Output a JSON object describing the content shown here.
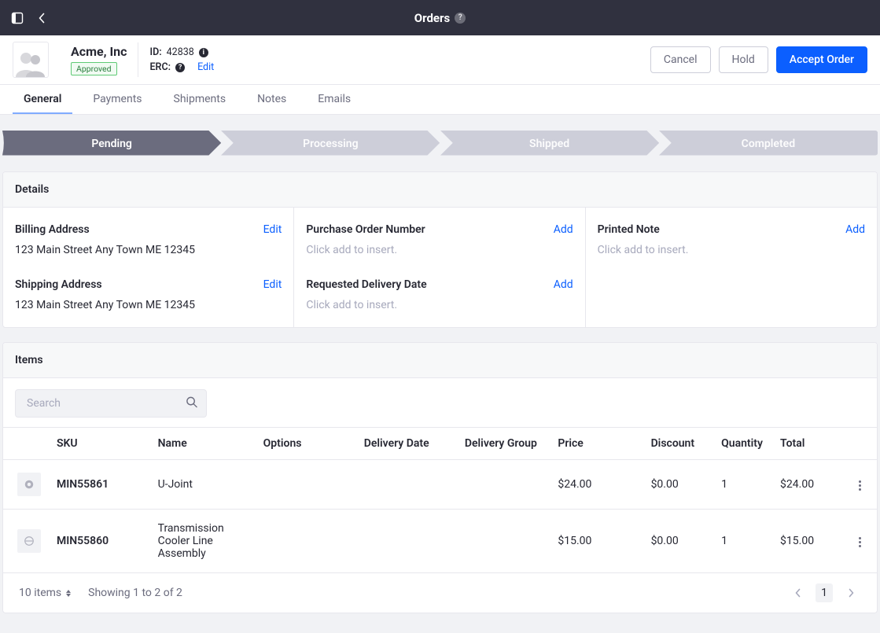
{
  "topbar": {
    "title": "Orders",
    "help_glyph": "?"
  },
  "header": {
    "customer_name": "Acme, Inc",
    "status_badge": "Approved",
    "id_label": "ID:",
    "id_value": "42838",
    "erc_label": "ERC:",
    "erc_help": "?",
    "edit_link": "Edit",
    "actions": {
      "cancel": "Cancel",
      "hold": "Hold",
      "accept": "Accept Order"
    }
  },
  "tabs": {
    "general": "General",
    "payments": "Payments",
    "shipments": "Shipments",
    "notes": "Notes",
    "emails": "Emails"
  },
  "steps": {
    "active_index": 0,
    "labels": {
      "pending": "Pending",
      "processing": "Processing",
      "shipped": "Shipped",
      "completed": "Completed"
    }
  },
  "details": {
    "panel_title": "Details",
    "billing_title": "Billing Address",
    "billing_value": "123 Main Street Any Town ME 12345",
    "billing_action": "Edit",
    "shipping_title": "Shipping Address",
    "shipping_value": "123 Main Street Any Town ME 12345",
    "shipping_action": "Edit",
    "po_title": "Purchase Order Number",
    "po_value": "Click add to insert.",
    "po_action": "Add",
    "date_title": "Requested Delivery Date",
    "date_value": "Click add to insert.",
    "date_action": "Add",
    "note_title": "Printed Note",
    "note_value": "Click add to insert.",
    "note_action": "Add"
  },
  "items": {
    "panel_title": "Items",
    "search_placeholder": "Search",
    "columns": {
      "sku": "SKU",
      "name": "Name",
      "options": "Options",
      "delivery_date": "Delivery Date",
      "delivery_group": "Delivery Group",
      "price": "Price",
      "discount": "Discount",
      "quantity": "Quantity",
      "total": "Total"
    },
    "rows": [
      {
        "sku": "MIN55861",
        "name": "U-Joint",
        "options": "",
        "delivery_date": "",
        "delivery_group": "",
        "price": "$24.00",
        "discount": "$0.00",
        "quantity": "1",
        "total": "$24.00"
      },
      {
        "sku": "MIN55860",
        "name": "Transmission Cooler Line Assembly",
        "options": "",
        "delivery_date": "",
        "delivery_group": "",
        "price": "$15.00",
        "discount": "$0.00",
        "quantity": "1",
        "total": "$15.00"
      }
    ],
    "footer": {
      "page_size_label": "10 items",
      "showing_text": "Showing 1 to 2 of 2",
      "current_page": "1"
    }
  }
}
